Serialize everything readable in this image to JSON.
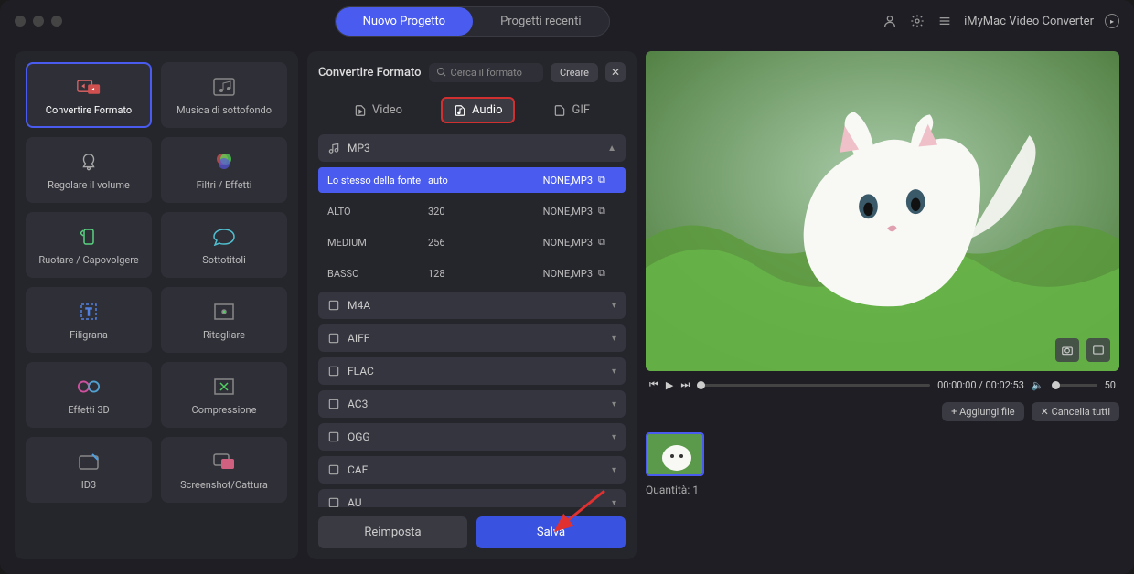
{
  "header": {
    "tab_new": "Nuovo Progetto",
    "tab_recent": "Progetti recenti",
    "app_title": "iMyMac Video Converter"
  },
  "sidebar": {
    "items": [
      {
        "label": "Convertire Formato",
        "icon": "convert-icon"
      },
      {
        "label": "Musica di sottofondo",
        "icon": "music-bg-icon"
      },
      {
        "label": "Regolare il volume",
        "icon": "volume-icon"
      },
      {
        "label": "Filtri / Effetti",
        "icon": "filters-icon"
      },
      {
        "label": "Ruotare / Capovolgere",
        "icon": "rotate-icon"
      },
      {
        "label": "Sottotitoli",
        "icon": "subtitle-icon"
      },
      {
        "label": "Filigrana",
        "icon": "watermark-icon"
      },
      {
        "label": "Ritagliare",
        "icon": "crop-icon"
      },
      {
        "label": "Effetti 3D",
        "icon": "3d-icon"
      },
      {
        "label": "Compressione",
        "icon": "compress-icon"
      },
      {
        "label": "ID3",
        "icon": "id3-icon"
      },
      {
        "label": "Screenshot/Cattura",
        "icon": "screenshot-icon"
      }
    ]
  },
  "center": {
    "title": "Convertire Formato",
    "search_placeholder": "Cerca il formato",
    "create_btn": "Creare",
    "subtabs": {
      "video": "Video",
      "audio": "Audio",
      "gif": "GIF"
    },
    "expanded_format": "MP3",
    "presets": [
      {
        "name": "Lo stesso della fonte",
        "bitrate": "auto",
        "codec": "NONE,MP3"
      },
      {
        "name": "ALTO",
        "bitrate": "320",
        "codec": "NONE,MP3"
      },
      {
        "name": "MEDIUM",
        "bitrate": "256",
        "codec": "NONE,MP3"
      },
      {
        "name": "BASSO",
        "bitrate": "128",
        "codec": "NONE,MP3"
      }
    ],
    "formats": [
      "M4A",
      "AIFF",
      "FLAC",
      "AC3",
      "OGG",
      "CAF",
      "AU"
    ],
    "reset_btn": "Reimposta",
    "save_btn": "Salva"
  },
  "preview": {
    "time_current": "00:00:00",
    "time_total": "00:02:53",
    "volume_value": "50",
    "add_file": "Aggiungi file",
    "clear_all": "Cancella tutti",
    "quantity_label": "Quantità:",
    "quantity_value": "1"
  }
}
